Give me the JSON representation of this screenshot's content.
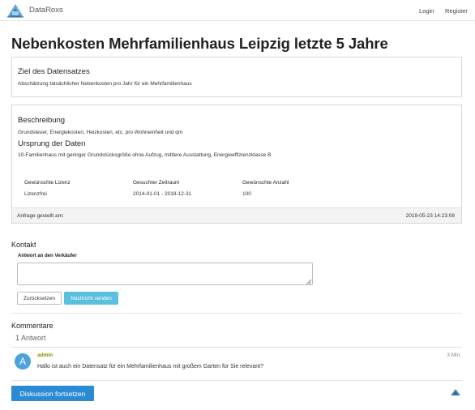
{
  "navbar": {
    "brand": "DataRoxs",
    "login": "Login",
    "register": "Register"
  },
  "page": {
    "title": "Nebenkosten Mehrfamilienhaus Leipzig letzte 5 Jahre"
  },
  "goal": {
    "heading": "Ziel des Datensatzes",
    "text": "Abschätzung tatsächlicher Nebenkosten pro Jahr für ein Mehrfamilienhaus"
  },
  "description": {
    "heading": "Beschreibung",
    "text": "Grundsteuer, Energiekosten, Heizkosten, etc. pro Wohneinheit und qm",
    "origin_heading": "Ursprung der Daten",
    "origin_text": "10-Familienhaus mit geringer Grundstücksgröße ohne Aufzug, mittlere Ausstattung, Energieeffizienzklasse B",
    "meta": [
      {
        "label": "Gewünschte Lizenz",
        "value": "Lizenzfrei"
      },
      {
        "label": "Gesuchter Zeitraum",
        "value": "2014-01-01 - 2018-12-31"
      },
      {
        "label": "Gewünschte Anzahl",
        "value": "100"
      }
    ],
    "footer_label": "Anfrage gestellt am:",
    "footer_date": "2019-05-23 14:23:08"
  },
  "contact": {
    "heading": "Kontakt",
    "field_label": "Antwort an den Verkäufer",
    "textarea_value": "",
    "reset_label": "Zurücksetzen",
    "send_label": "Nachricht senden"
  },
  "comments": {
    "heading": "Kommentare",
    "count_label": "1 Antwort",
    "items": [
      {
        "avatar_letter": "A",
        "author": "admin",
        "time": "3 Min.",
        "text": "Hallo ist auch ein Datensatz für ein Mehrfamilienhaus mit großem Garten für Sie relevant?"
      }
    ],
    "continue_label": "Diskussion fortsetzen"
  },
  "colors": {
    "accent": "#2a8ad4",
    "send_button": "#5bc0de",
    "avatar": "#4aa3df",
    "author": "#8a8a00"
  },
  "icons": {
    "logo": "dataroxs-logo-icon",
    "resize": "resize-grip-icon"
  }
}
